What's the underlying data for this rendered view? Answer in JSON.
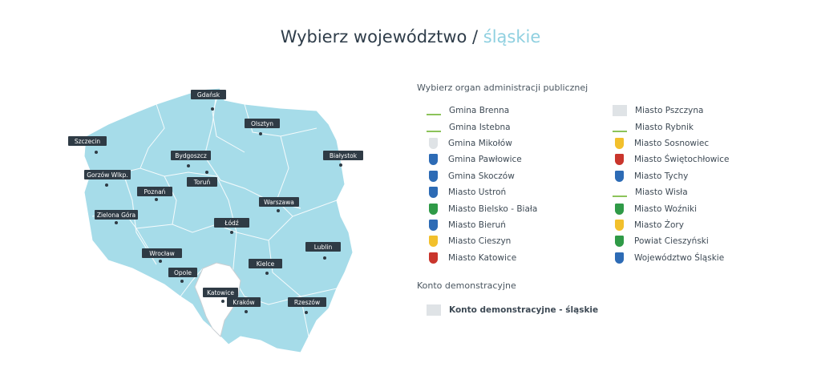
{
  "header": {
    "title_main": "Wybierz województwo /",
    "title_accent": "śląskie"
  },
  "map": {
    "fill_color": "#a6dce9",
    "highlight_color": "#ffffff",
    "cities": [
      "Gdańsk",
      "Olsztyn",
      "Szczecin",
      "Bydgoszcz",
      "Białystok",
      "Gorzów Wlkp.",
      "Toruń",
      "Poznań",
      "Warszawa",
      "Zielona Góra",
      "Łódź",
      "Lublin",
      "Wrocław",
      "Kielce",
      "Opole",
      "Katowice",
      "Kraków",
      "Rzeszów"
    ]
  },
  "panel": {
    "section_title": "Wybierz organ administracji publicznej",
    "left_items": [
      {
        "name": "Gmina Brenna",
        "icon": "brenna-logo-icon"
      },
      {
        "name": "Gmina Istebna",
        "icon": "istebna-logo-icon"
      },
      {
        "name": "Gmina Mikołów",
        "icon": "mikolow-crest-icon"
      },
      {
        "name": "Gmina Pawłowice",
        "icon": "pawlowice-crest-icon"
      },
      {
        "name": "Gmina Skoczów",
        "icon": "skoczow-crest-icon"
      },
      {
        "name": "Miasto Ustroń",
        "icon": "ustron-crest-icon"
      },
      {
        "name": "Miasto Bielsko - Biała",
        "icon": "bielsko-biala-crest-icon"
      },
      {
        "name": "Miasto Bieruń",
        "icon": "bierun-crest-icon"
      },
      {
        "name": "Miasto Cieszyn",
        "icon": "cieszyn-logo-icon"
      },
      {
        "name": "Miasto Katowice",
        "icon": "katowice-logo-icon"
      }
    ],
    "right_items": [
      {
        "name": "Miasto Pszczyna",
        "icon": "pszczyna-logo-icon"
      },
      {
        "name": "Miasto Rybnik",
        "icon": "rybnik-logo-icon"
      },
      {
        "name": "Miasto Sosnowiec",
        "icon": "sosnowiec-logo-icon"
      },
      {
        "name": "Miasto Świętochłowice",
        "icon": "swietochlowice-crest-icon"
      },
      {
        "name": "Miasto Tychy",
        "icon": "tychy-crest-icon"
      },
      {
        "name": "Miasto Wisła",
        "icon": "wisla-logo-icon"
      },
      {
        "name": "Miasto Woźniki",
        "icon": "wozniki-crest-icon"
      },
      {
        "name": "Miasto Żory",
        "icon": "zory-crest-icon"
      },
      {
        "name": "Powiat Cieszyński",
        "icon": "powiat-cieszynski-crest-icon"
      },
      {
        "name": "Województwo Śląskie",
        "icon": "wojewodztwo-slaskie-crest-icon"
      }
    ],
    "demo_title": "Konto demonstracyjne",
    "demo_item": "Konto demonstracyjne - śląskie"
  }
}
